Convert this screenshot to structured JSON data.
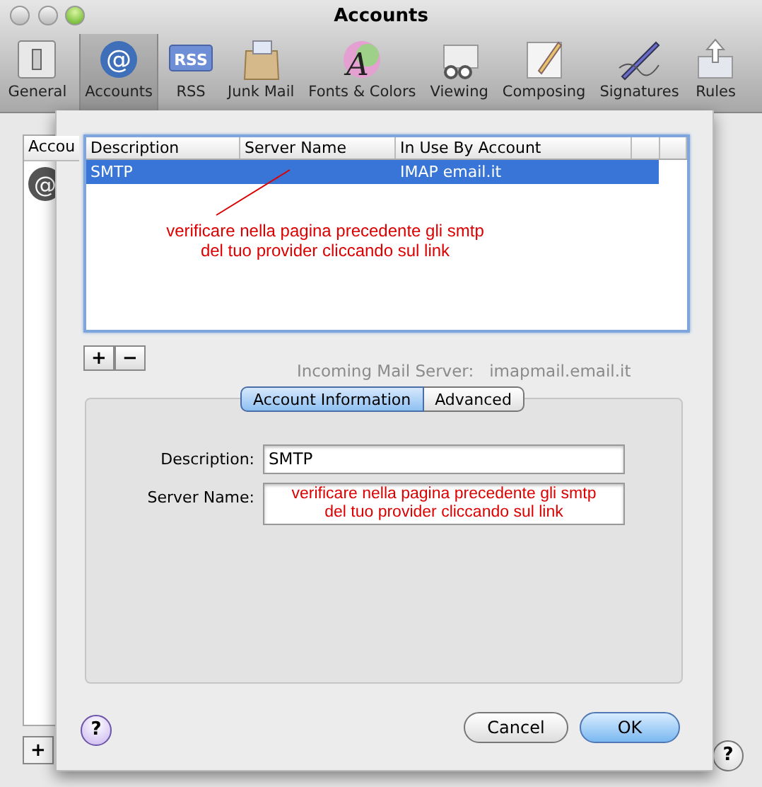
{
  "window": {
    "title": "Accounts"
  },
  "toolbar": [
    {
      "label": "General",
      "selected": false
    },
    {
      "label": "Accounts",
      "glyph": "@",
      "selected": true
    },
    {
      "label": "RSS",
      "glyph": "RSS",
      "selected": false
    },
    {
      "label": "Junk Mail",
      "selected": false
    },
    {
      "label": "Fonts & Colors",
      "glyph": "A",
      "selected": false
    },
    {
      "label": "Viewing",
      "selected": false
    },
    {
      "label": "Composing",
      "selected": false
    },
    {
      "label": "Signatures",
      "selected": false
    },
    {
      "label": "Rules",
      "selected": false
    }
  ],
  "background": {
    "list_header": "Accou",
    "account_glyph": "@",
    "incoming_label": "Incoming Mail Server:",
    "incoming_value": "imapmail.email.it"
  },
  "sheet": {
    "table": {
      "columns": [
        "Description",
        "Server Name",
        "In Use By Account"
      ],
      "rows": [
        {
          "cells": [
            "SMTP",
            "",
            "IMAP email.it"
          ],
          "selected": true
        }
      ],
      "annotation": {
        "lines": [
          "verificare nella pagina precedente gli smtp",
          "del tuo provider cliccando sul link"
        ],
        "color": "#dd0000"
      }
    },
    "add_remove": [
      "+",
      "−"
    ],
    "tabs": [
      {
        "label": "Account Information",
        "selected": true
      },
      {
        "label": "Advanced",
        "selected": false
      }
    ],
    "fields": [
      {
        "label": "Description:",
        "kind": "text",
        "value": "SMTP"
      },
      {
        "label": "Server Name:",
        "kind": "note",
        "lines": [
          "verificare nella pagina precedente gli smtp",
          "del tuo provider cliccando sul link"
        ],
        "color": "#dd0000"
      }
    ],
    "help": "?",
    "buttons": [
      {
        "label": "Cancel",
        "kind": "normal"
      },
      {
        "label": "OK",
        "kind": "default"
      }
    ]
  },
  "bottom": {
    "add": "+",
    "help": "?"
  }
}
